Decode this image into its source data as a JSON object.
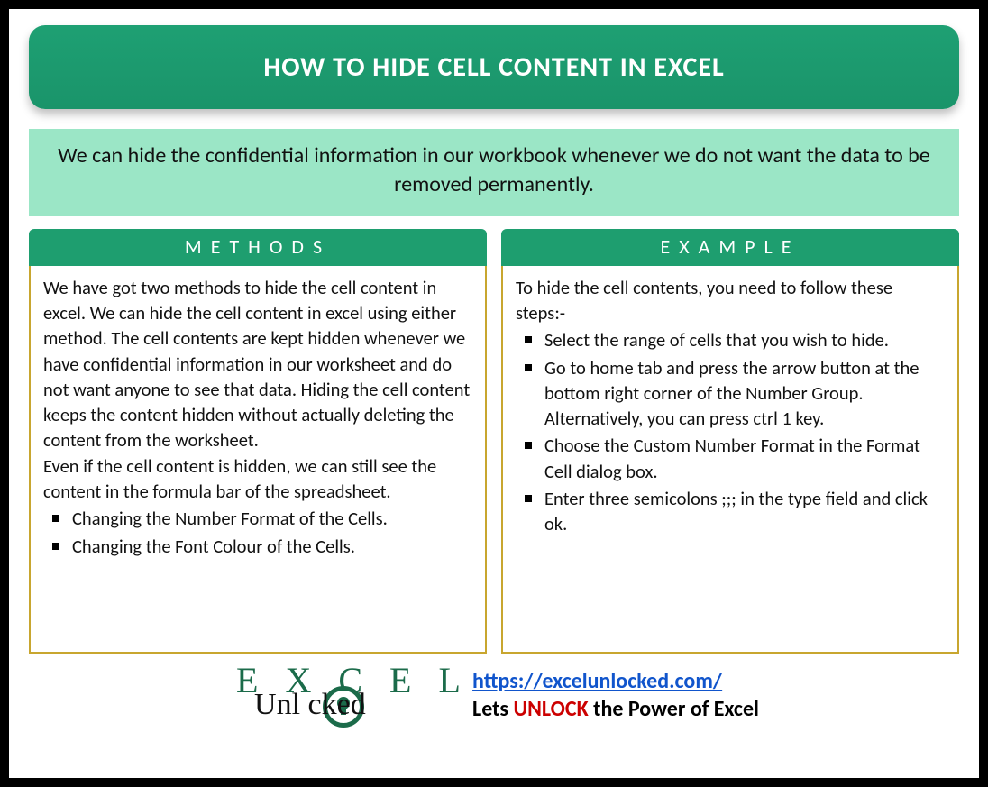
{
  "title": "HOW TO HIDE CELL CONTENT IN EXCEL",
  "intro": "We can hide the confidential information in our workbook whenever we do not want the data to be removed permanently.",
  "methods": {
    "header": "METHODS",
    "para1": "We have got two methods to hide the cell content in excel. We can hide the cell content in excel using either method. The cell contents are kept hidden whenever we have confidential information in our worksheet and do not want anyone to see that data. Hiding the cell content keeps the content hidden without actually deleting the content from the worksheet.",
    "para2": "Even if the cell content is hidden, we can still see the content in the formula bar of the spreadsheet.",
    "bullets": [
      "Changing the Number Format of the Cells.",
      "Changing the Font Colour of the Cells."
    ]
  },
  "example": {
    "header": "EXAMPLE",
    "intro": "To hide the cell contents, you need to follow these steps:-",
    "bullets": [
      "Select the range of cells that you wish to hide.",
      "Go to home tab and press the arrow button at the bottom right corner of the Number Group. Alternatively, you can press ctrl 1 key.",
      "Choose the Custom Number Format in the Format Cell dialog box.",
      "Enter three semicolons ;;; in the type field and click ok."
    ]
  },
  "footer": {
    "logo_top": "E X C E L",
    "logo_bottom": "Unl   cked",
    "url": "https://excelunlocked.com/",
    "tagline_pre": "Lets ",
    "tagline_highlight": "UNLOCK",
    "tagline_post": " the Power of Excel"
  }
}
